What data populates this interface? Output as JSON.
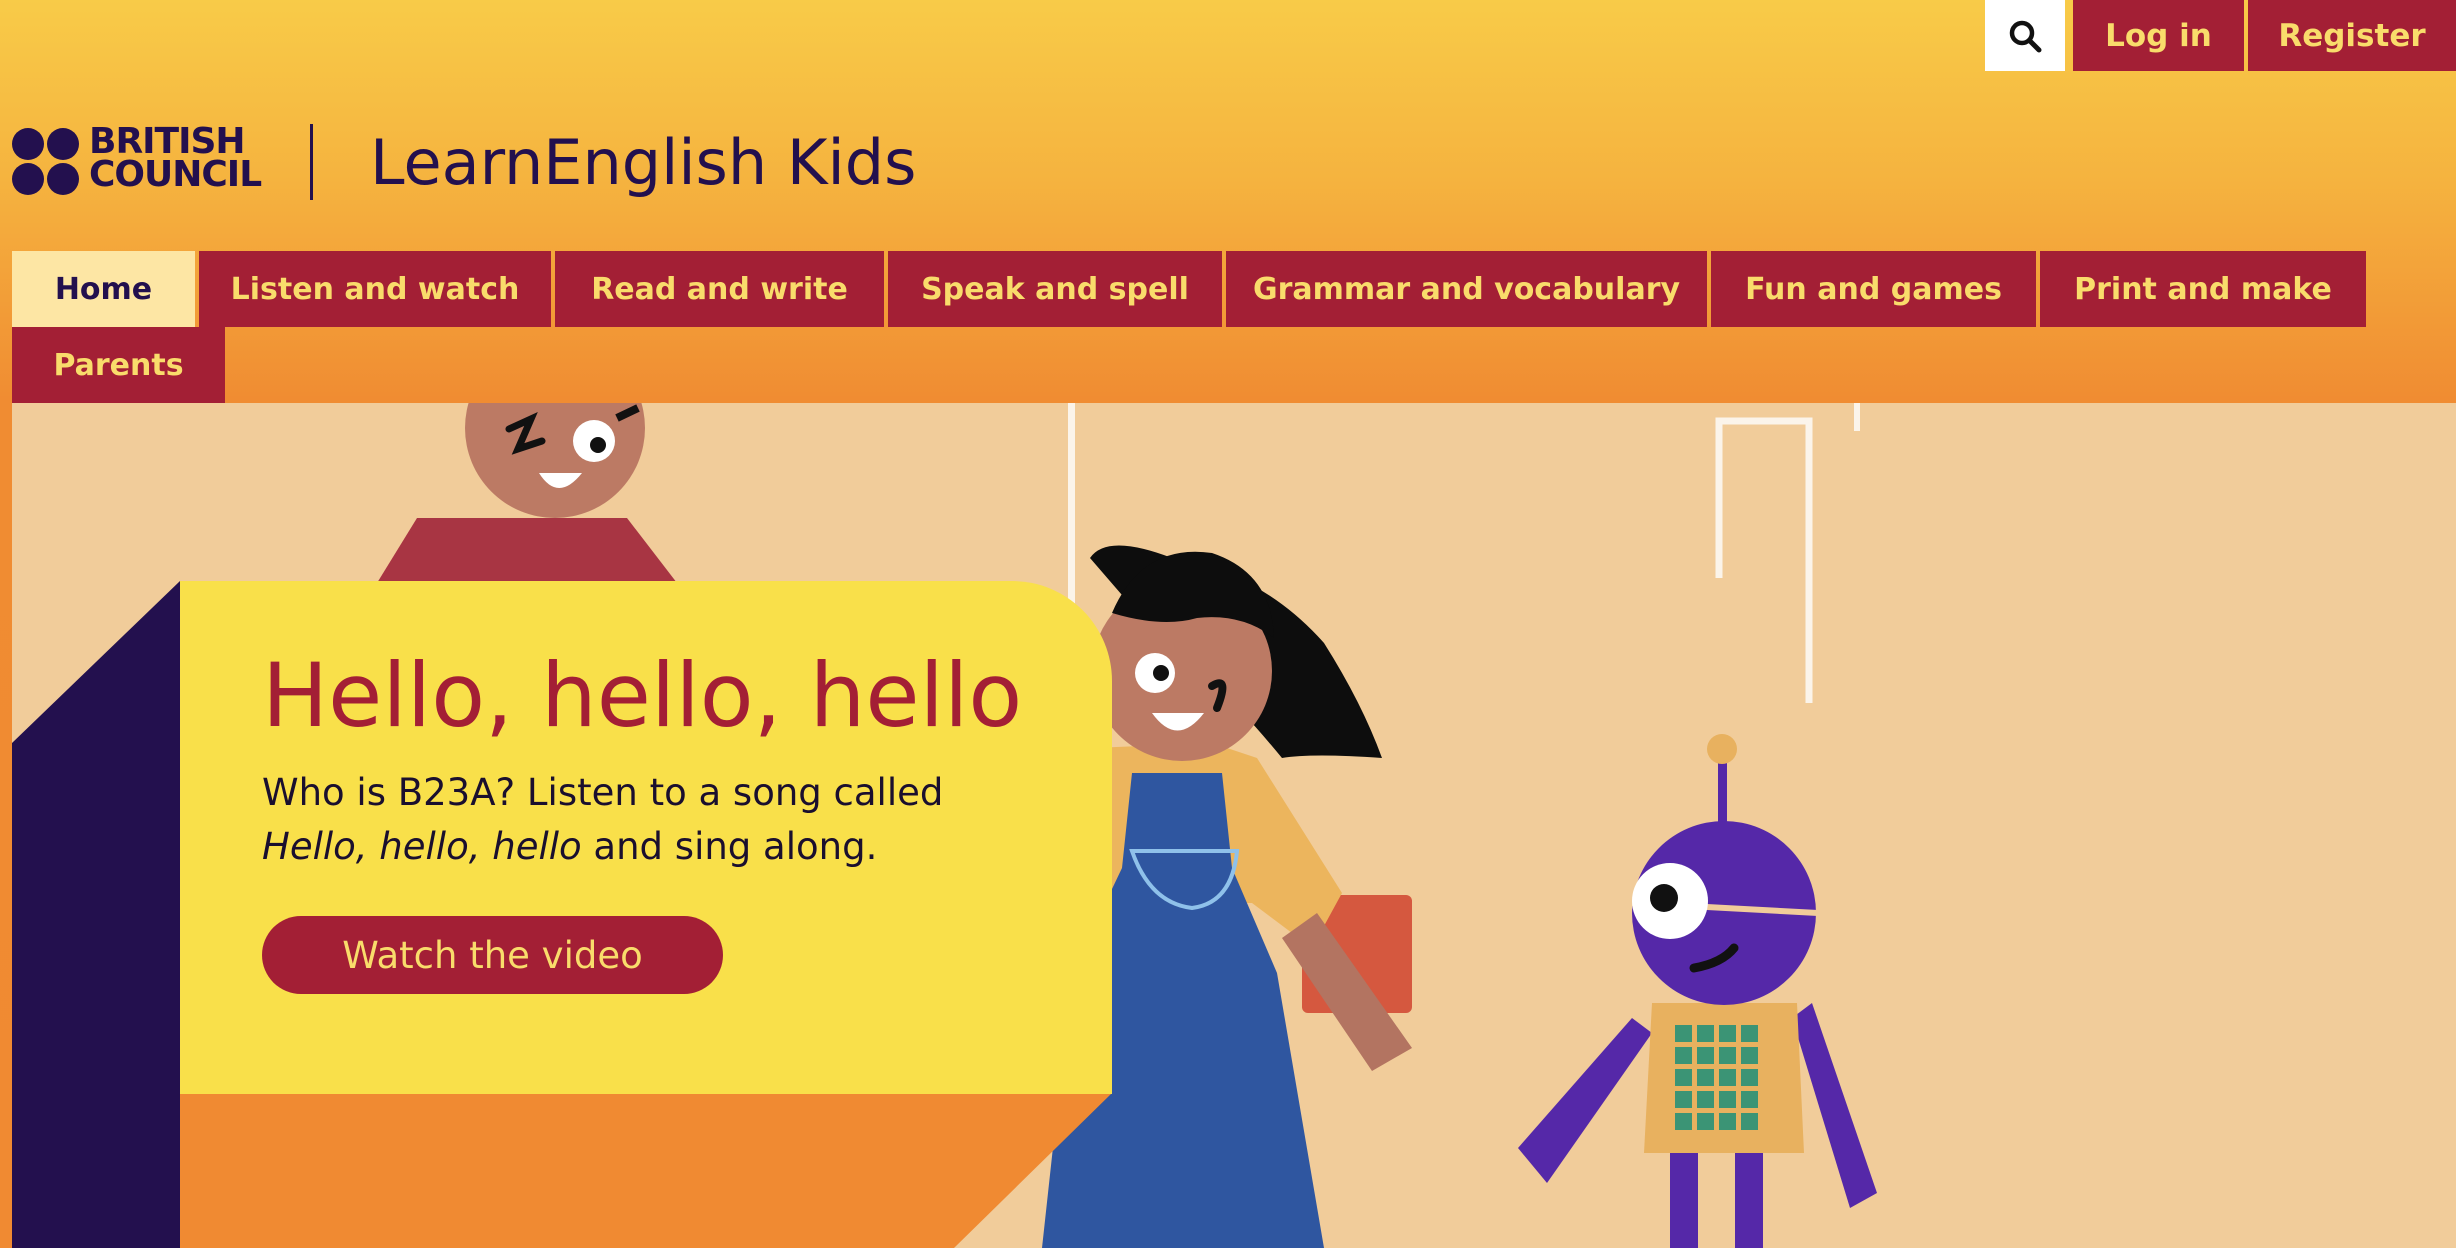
{
  "utility": {
    "search_icon": "search-icon",
    "login_label": "Log in",
    "register_label": "Register"
  },
  "header": {
    "brand_text": "BRITISH\nCOUNCIL",
    "site_title": "LearnEnglish Kids"
  },
  "nav": {
    "items": [
      {
        "label": "Home",
        "active": true
      },
      {
        "label": "Listen and watch"
      },
      {
        "label": "Read and write"
      },
      {
        "label": "Speak and spell"
      },
      {
        "label": "Grammar and vocabulary"
      },
      {
        "label": "Fun and games"
      },
      {
        "label": "Print and make"
      },
      {
        "label": "Parents"
      }
    ]
  },
  "hero": {
    "title": "Hello, hello, hello",
    "desc_prefix": "Who is B23A? Listen to a song called ",
    "desc_em": "Hello, hello, hello",
    "desc_suffix": " and sing along.",
    "button_label": "Watch the video"
  },
  "colors": {
    "brand_red": "#a31f35",
    "brand_yellow": "#f9dc6b",
    "navy": "#23104e",
    "card_yellow": "#f9e04a",
    "hero_bg": "#f1cc9a"
  }
}
